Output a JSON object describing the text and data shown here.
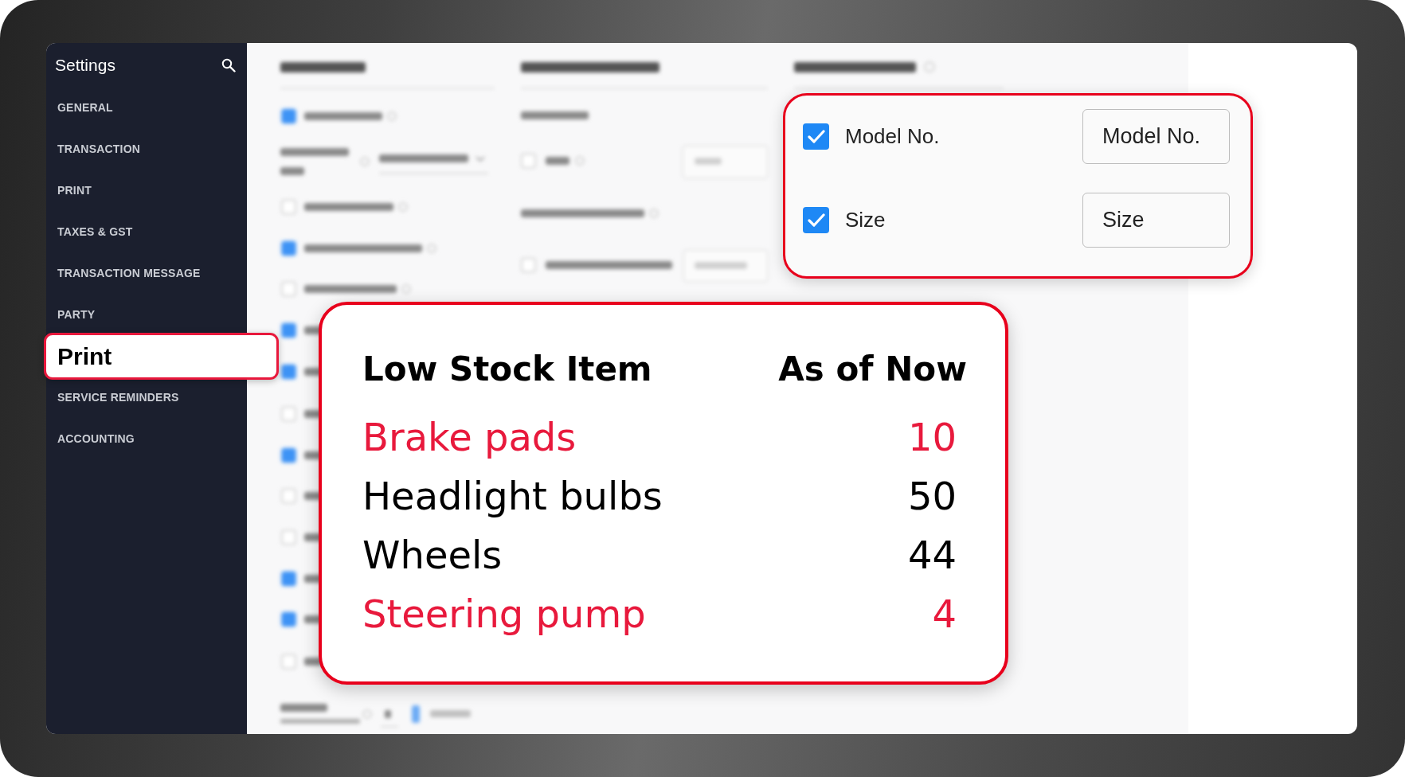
{
  "sidebar": {
    "title": "Settings",
    "items": [
      {
        "label": "GENERAL",
        "selected": false
      },
      {
        "label": "TRANSACTION",
        "selected": false
      },
      {
        "label": "PRINT",
        "selected": false
      },
      {
        "label": "TAXES & GST",
        "selected": false
      },
      {
        "label": "TRANSACTION MESSAGE",
        "selected": false
      },
      {
        "label": "PARTY",
        "selected": false
      },
      {
        "label": "Print",
        "selected": true
      },
      {
        "label": "SERVICE REMINDERS",
        "selected": false
      },
      {
        "label": "ACCOUNTING",
        "selected": false
      }
    ]
  },
  "custom_fields": [
    {
      "label": "Model No.",
      "checked": true,
      "value": "Model No."
    },
    {
      "label": "Size",
      "checked": true,
      "value": "Size"
    }
  ],
  "low_stock": {
    "columns": [
      "Low Stock Item",
      "As of Now"
    ],
    "rows": [
      {
        "item": "Brake pads",
        "quantity": "10",
        "alert": true
      },
      {
        "item": "Headlight bulbs",
        "quantity": "50",
        "alert": false
      },
      {
        "item": "Wheels",
        "quantity": "44",
        "alert": false
      },
      {
        "item": "Steering pump",
        "quantity": "4",
        "alert": true
      }
    ]
  }
}
